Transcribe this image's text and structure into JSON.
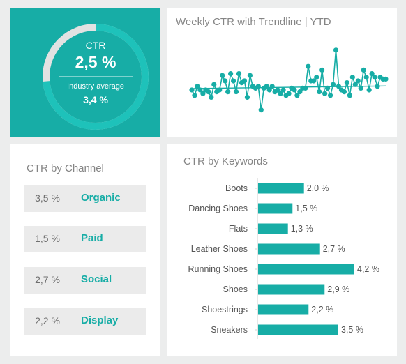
{
  "ctr_kpi": {
    "label": "CTR",
    "value": "2,5 %",
    "industry_label": "Industry average",
    "industry_value": "3,4 %",
    "fill_fraction": 0.735,
    "ring_color": "#1ec2ba",
    "ring_track_color": "#e2e2e2"
  },
  "trend_panel": {
    "title": "Weekly CTR with Trendline | YTD"
  },
  "channel_panel": {
    "title": "CTR by Channel",
    "items": [
      {
        "value": "3,5 %",
        "name": "Organic"
      },
      {
        "value": "1,5 %",
        "name": "Paid"
      },
      {
        "value": "2,7 %",
        "name": "Social"
      },
      {
        "value": "2,2 %",
        "name": "Display"
      }
    ]
  },
  "keyword_panel": {
    "title": "CTR by Keywords"
  },
  "colors": {
    "accent": "#17ada6",
    "background": "#eceded",
    "panel": "#ffffff"
  },
  "chart_data": [
    {
      "type": "line",
      "title": "Weekly CTR with Trendline | YTD",
      "series": [
        {
          "values": [
            2.3,
            2.0,
            2.5,
            2.3,
            2.1,
            2.3,
            2.2,
            1.9,
            2.6,
            2.2,
            2.3,
            3.1,
            2.8,
            2.2,
            3.2,
            2.8,
            2.2,
            3.2,
            2.7,
            2.8,
            1.9,
            3.1,
            2.5,
            2.4,
            2.5,
            1.2,
            2.4,
            2.5,
            2.3,
            2.5,
            2.2,
            2.3,
            2.1,
            2.3,
            2.0,
            2.1,
            2.4,
            2.3,
            2.0,
            2.2,
            2.4,
            2.4,
            3.6,
            2.8,
            2.8,
            3.0,
            2.2,
            3.4,
            2.1,
            2.4,
            2.0,
            2.6,
            4.5,
            2.5,
            2.3,
            2.2,
            2.7,
            2.0,
            3.0,
            2.6,
            2.8,
            2.4,
            3.4,
            3.0,
            2.3,
            3.2,
            3.0,
            2.5,
            3.0,
            2.9,
            2.9
          ]
        }
      ],
      "trendline": [
        2.38,
        2.52
      ],
      "ylim": [
        0.8,
        4.8
      ],
      "grid": false,
      "legend": "none",
      "color": "#17ada6"
    },
    {
      "type": "bar",
      "orientation": "horizontal",
      "title": "CTR by Keywords",
      "categories": [
        "Boots",
        "Dancing Shoes",
        "Flats",
        "Leather Shoes",
        "Running Shoes",
        "Shoes",
        "Shoestrings",
        "Sneakers"
      ],
      "values": [
        2.0,
        1.5,
        1.3,
        2.7,
        4.2,
        2.9,
        2.2,
        3.5
      ],
      "value_labels": [
        "2,0 %",
        "1,5 %",
        "1,3 %",
        "2,7 %",
        "4,2 %",
        "2,9 %",
        "2,2 %",
        "3,5 %"
      ],
      "xlim": [
        0,
        4.2
      ],
      "color": "#17ada6"
    }
  ]
}
